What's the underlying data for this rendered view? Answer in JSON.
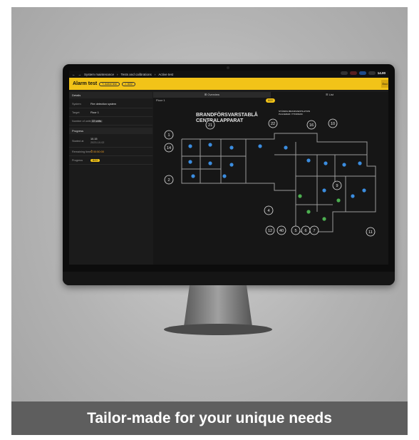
{
  "caption": "Tailor-made  for your unique needs",
  "topbar": {
    "back_icon": "back-arrow-icon",
    "crumb1": "System maintenance",
    "crumb2": "Tests and calibrations",
    "crumb3": "Active test",
    "time": "14.00"
  },
  "header": {
    "title": "Alarm test",
    "badge_active": "Active test",
    "badge_count": "8/22",
    "end_button": "End"
  },
  "details": {
    "heading": "Details",
    "system_label": "System",
    "system_value": "Fire detection system",
    "target_label": "Target",
    "target_value": "Floor 1",
    "units_label": "Number of units",
    "units_value": "22 units"
  },
  "progress": {
    "heading": "Progress",
    "started_label": "Started at",
    "started_time": "10.15",
    "started_date": "2023-10-02",
    "remaining_label": "Remaining time",
    "remaining_value": "00:50:00",
    "progress_label": "Progress",
    "progress_value": "8/22"
  },
  "tabs": {
    "overview": "Overview",
    "list": "List"
  },
  "floor": {
    "name": "Floor 1",
    "badge": "8/22"
  },
  "plan_labels": {
    "cabinet_line1": "BRANDFÖRSVARSTABLÅ",
    "cabinet_line2": "CENTRALAPPARAT",
    "trapphus_a": "STÄNDIG BRANDVENTILATION",
    "trapphus_b": "PLACERAD I TTORNUM"
  },
  "plan_numbers": [
    "1",
    "14",
    "2",
    "21",
    "22",
    "16",
    "10",
    "9",
    "4",
    "12",
    "40",
    "5",
    "6",
    "7",
    "11"
  ],
  "colors": {
    "accent": "#f2c318",
    "detector": "#3b8de0",
    "tested": "#4caf50"
  }
}
